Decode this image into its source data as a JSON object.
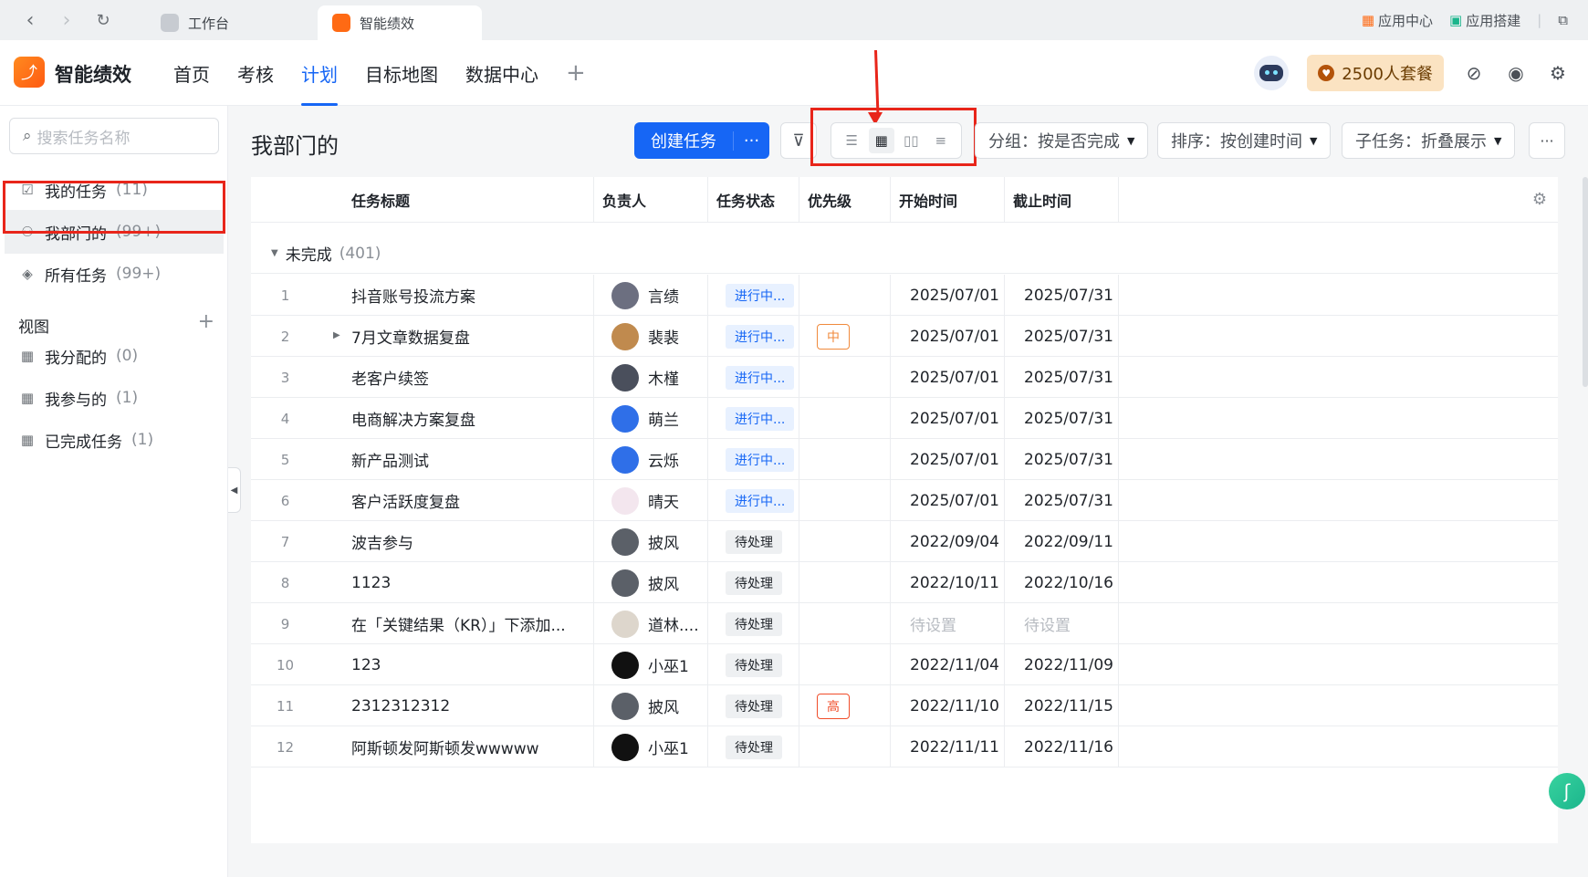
{
  "browser": {
    "tabs": [
      {
        "label": "工作台"
      },
      {
        "label": "智能绩效"
      }
    ],
    "right": [
      {
        "label": "应用中心"
      },
      {
        "label": "应用搭建"
      }
    ]
  },
  "app": {
    "brand": "智能绩效",
    "menu": [
      "首页",
      "考核",
      "计划",
      "目标地图",
      "数据中心"
    ],
    "active_menu": "计划",
    "plan_label": "2500人套餐"
  },
  "sidebar": {
    "search_placeholder": "搜索任务名称",
    "items": [
      {
        "label": "我的任务",
        "count": "(11)"
      },
      {
        "label": "我部门的",
        "count": "(99+)"
      },
      {
        "label": "所有任务",
        "count": "(99+)"
      }
    ],
    "views_title": "视图",
    "views": [
      {
        "label": "我分配的",
        "count": "(0)"
      },
      {
        "label": "我参与的",
        "count": "(1)"
      },
      {
        "label": "已完成任务",
        "count": "(1)"
      }
    ]
  },
  "toolbar": {
    "title": "我部门的",
    "create_label": "创建任务",
    "more_label": "···",
    "group_label": "分组：按是否完成",
    "sort_label": "排序：按创建时间",
    "subtask_label": "子任务：折叠展示",
    "ellipsis": "···"
  },
  "table": {
    "headers": [
      "任务标题",
      "负责人",
      "任务状态",
      "优先级",
      "开始时间",
      "截止时间"
    ],
    "group": {
      "label": "未完成",
      "count": "(401)"
    },
    "rows": [
      {
        "num": "1",
        "title": "抖音账号投流方案",
        "owner": "言绩",
        "status": "进行中...",
        "priority": "",
        "start": "2025/07/01",
        "end": "2025/07/31"
      },
      {
        "num": "2",
        "title": "7月文章数据复盘",
        "owner": "裴裴",
        "status": "进行中...",
        "priority": "中",
        "start": "2025/07/01",
        "end": "2025/07/31"
      },
      {
        "num": "3",
        "title": "老客户续签",
        "owner": "木槿",
        "status": "进行中...",
        "priority": "",
        "start": "2025/07/01",
        "end": "2025/07/31"
      },
      {
        "num": "4",
        "title": "电商解决方案复盘",
        "owner": "萌兰",
        "status": "进行中...",
        "priority": "",
        "start": "2025/07/01",
        "end": "2025/07/31"
      },
      {
        "num": "5",
        "title": "新产品测试",
        "owner": "云烁",
        "status": "进行中...",
        "priority": "",
        "start": "2025/07/01",
        "end": "2025/07/31"
      },
      {
        "num": "6",
        "title": "客户活跃度复盘",
        "owner": "晴天",
        "status": "进行中...",
        "priority": "",
        "start": "2025/07/01",
        "end": "2025/07/31"
      },
      {
        "num": "7",
        "title": "波吉参与",
        "owner": "披风",
        "status": "待处理",
        "priority": "",
        "start": "2022/09/04",
        "end": "2022/09/11"
      },
      {
        "num": "8",
        "title": "1123",
        "owner": "披风",
        "status": "待处理",
        "priority": "",
        "start": "2022/10/11",
        "end": "2022/10/16"
      },
      {
        "num": "9",
        "title": "在「关键结果（KR）」下添加...",
        "owner": "道林....",
        "status": "待处理",
        "priority": "",
        "start": "待设置",
        "end": "待设置"
      },
      {
        "num": "10",
        "title": "123",
        "owner": "小巫1",
        "status": "待处理",
        "priority": "",
        "start": "2022/11/04",
        "end": "2022/11/09"
      },
      {
        "num": "11",
        "title": "2312312312",
        "owner": "披风",
        "status": "待处理",
        "priority": "高",
        "start": "2022/11/10",
        "end": "2022/11/15"
      },
      {
        "num": "12",
        "title": "阿斯顿发阿斯顿发wwwww",
        "owner": "小巫1",
        "status": "待处理",
        "priority": "",
        "start": "2022/11/11",
        "end": "2022/11/16"
      }
    ]
  },
  "colors": {
    "accent": "#1666f5",
    "highlight": "#e8251a",
    "brand_orange": "#ff6a14"
  }
}
